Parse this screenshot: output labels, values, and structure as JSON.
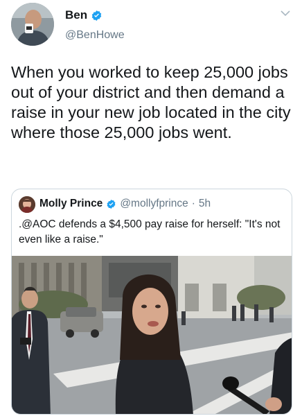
{
  "tweet": {
    "author": {
      "display_name": "Ben",
      "handle": "@BenHowe",
      "verified": true
    },
    "text": "When you worked to keep 25,000 jobs out of your district and then demand a raise in your new job located in the city where those 25,000 jobs went.",
    "menu_icon": "chevron-down-icon",
    "quoted": {
      "author": {
        "display_name": "Molly Prince",
        "handle": "@mollyfprince",
        "verified": true
      },
      "separator": "·",
      "time": "5h",
      "text": ".@AOC defends a $4,500 pay raise for herself: \"It's not even like a raise.\"",
      "media": "photo"
    }
  },
  "colors": {
    "text": "#14171a",
    "secondary": "#657786",
    "verified": "#1da1f2",
    "border": "#ccd6dd"
  }
}
